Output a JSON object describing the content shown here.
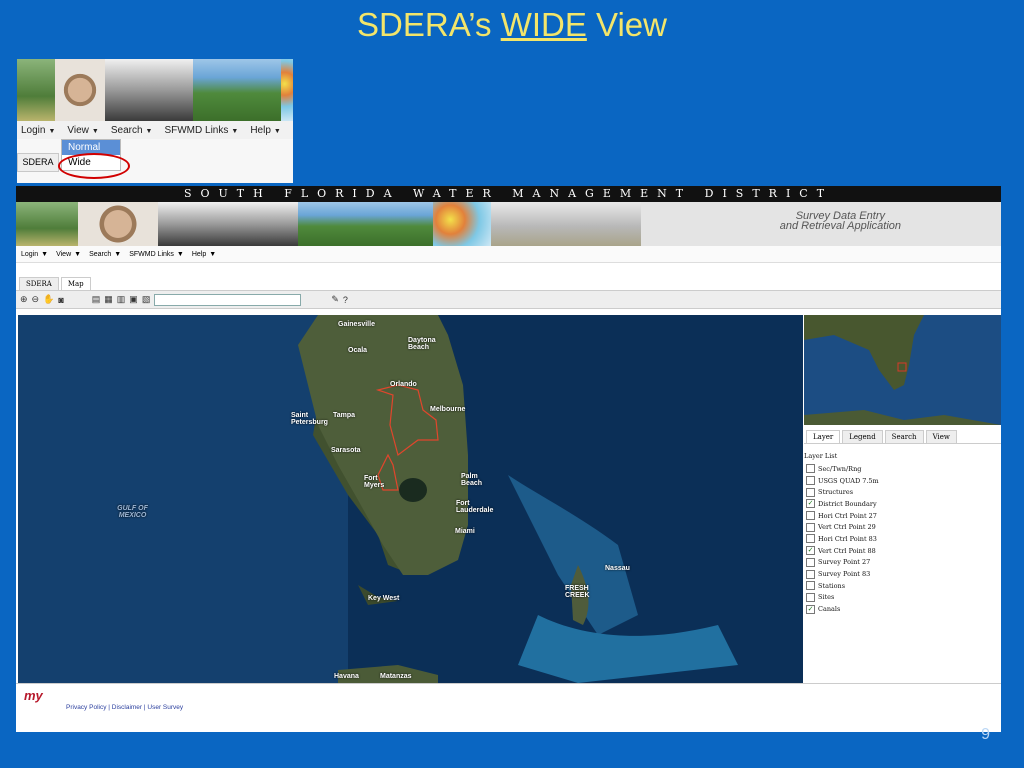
{
  "slide": {
    "title_prefix": "SDERA’s ",
    "title_emph": "WIDE",
    "title_suffix": " View",
    "page_number": "9"
  },
  "inset": {
    "menu": [
      "Login",
      "View",
      "Search",
      "SFWMD Links",
      "Help"
    ],
    "tab": "SDERA",
    "dropdown": [
      "Normal",
      "Wide"
    ]
  },
  "app": {
    "header": "SOUTH FLORIDA WATER MANAGEMENT DISTRICT",
    "banner_line1": "Survey Data Entry",
    "banner_line2": "and Retrieval Application",
    "menu": [
      "Login",
      "View",
      "Search",
      "SFWMD Links",
      "Help"
    ],
    "tabs": [
      "SDERA",
      "Map"
    ],
    "map_labels": {
      "gainesville": "Gainesville",
      "ocala": "Ocala",
      "daytona": "Daytona Beach",
      "orlando": "Orlando",
      "saint_petersburg": "Saint Petersburg",
      "tampa": "Tampa",
      "melbourne": "Melbourne",
      "sarasota": "Sarasota",
      "fort_myers": "Fort Myers",
      "palm_beach": "Palm Beach",
      "fort_lauderdale": "Fort Lauderdale",
      "miami": "Miami",
      "gulf": "GULF OF MEXICO",
      "nassau": "Nassau",
      "fresh_creek": "FRESH CREEK",
      "key_west": "Key West",
      "havana": "Havana",
      "matanzas": "Matanzas"
    },
    "panel_tabs": [
      "Layer",
      "Legend",
      "Search",
      "View"
    ],
    "layer_list_title": "Layer List",
    "layers": [
      {
        "name": "Sec/Twn/Rng",
        "checked": false
      },
      {
        "name": "USGS QUAD 7.5m",
        "checked": false
      },
      {
        "name": "Structures",
        "checked": false
      },
      {
        "name": "District Boundary",
        "checked": true
      },
      {
        "name": "Hori Ctrl Point 27",
        "checked": false
      },
      {
        "name": "Vert Ctrl Point 29",
        "checked": false
      },
      {
        "name": "Hori Ctrl Point 83",
        "checked": false
      },
      {
        "name": "Vert Ctrl Point 88",
        "checked": true
      },
      {
        "name": "Survey Point 27",
        "checked": false
      },
      {
        "name": "Survey Point 83",
        "checked": false
      },
      {
        "name": "Stations",
        "checked": false
      },
      {
        "name": "Sites",
        "checked": false
      },
      {
        "name": "Canals",
        "checked": true
      }
    ],
    "footer_logo": "my",
    "footer_links": "Privacy Policy | Disclaimer | User Survey"
  }
}
